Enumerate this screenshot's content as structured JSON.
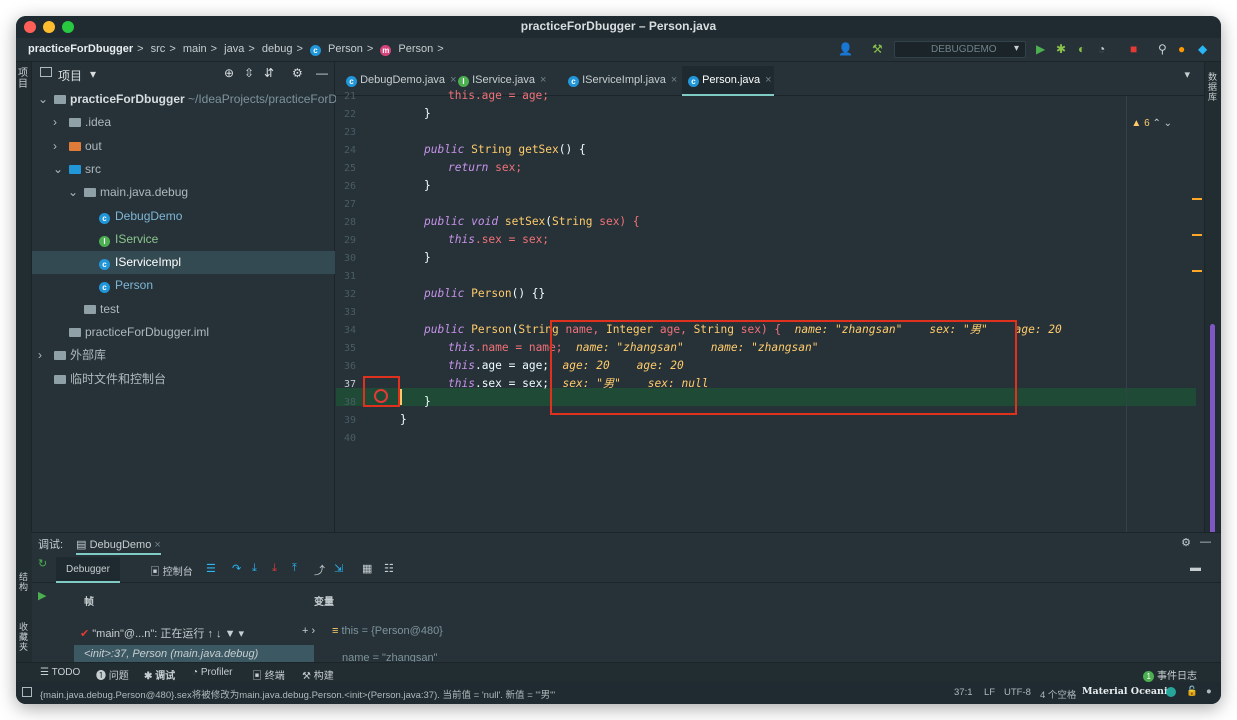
{
  "window": {
    "title": "practiceForDbugger – Person.java"
  },
  "navbar": {
    "crumbs": [
      "practiceForDbugger",
      "src",
      "main",
      "java",
      "debug",
      "Person",
      "Person"
    ],
    "sep": ">",
    "run_config": "DEBUGDEMO"
  },
  "project": {
    "title": "项目",
    "items": [
      {
        "label": "practiceForDbugger",
        "extra": "~/IdeaProjects/practiceForDl",
        "indent": 0,
        "arrow": "v",
        "icon": "module"
      },
      {
        "label": ".idea",
        "indent": 1,
        "arrow": ">",
        "icon": "folder"
      },
      {
        "label": "out",
        "indent": 1,
        "arrow": ">",
        "icon": "folder-orange"
      },
      {
        "label": "src",
        "indent": 1,
        "arrow": "v",
        "icon": "folder-blue"
      },
      {
        "label": "main.java.debug",
        "indent": 2,
        "arrow": "v",
        "icon": "package"
      },
      {
        "label": "DebugDemo",
        "indent": 3,
        "arrow": "",
        "icon": "class-run"
      },
      {
        "label": "IService",
        "indent": 3,
        "arrow": "",
        "icon": "interface"
      },
      {
        "label": "IServiceImpl",
        "indent": 3,
        "arrow": "",
        "icon": "class",
        "selected": true
      },
      {
        "label": "Person",
        "indent": 3,
        "arrow": "",
        "icon": "class"
      },
      {
        "label": "test",
        "indent": 2,
        "arrow": "",
        "icon": "folder"
      },
      {
        "label": "practiceForDbugger.iml",
        "indent": 1,
        "arrow": "",
        "icon": "iml"
      },
      {
        "label": "外部库",
        "indent": 0,
        "arrow": ">",
        "icon": "library"
      },
      {
        "label": "临时文件和控制台",
        "indent": 0,
        "arrow": "",
        "icon": "scratch"
      }
    ]
  },
  "tabs": [
    {
      "label": "DebugDemo.java",
      "icon": "class-run"
    },
    {
      "label": "IService.java",
      "icon": "interface"
    },
    {
      "label": "IServiceImpl.java",
      "icon": "class"
    },
    {
      "label": "Person.java",
      "icon": "class",
      "active": true
    }
  ],
  "editor": {
    "line_numbers": [
      "21",
      "22",
      "23",
      "24",
      "25",
      "26",
      "27",
      "28",
      "29",
      "30",
      "31",
      "32",
      "33",
      "34",
      "35",
      "36",
      "37",
      "38",
      "39",
      "40"
    ],
    "warning_count": "6",
    "code": {
      "l21": "this.age = age;",
      "l22": "}",
      "l24a": "public",
      "l24b": "String",
      "l24c": "getSex",
      "l24d": "() {",
      "l25a": "return",
      "l25b": "sex;",
      "l26": "}",
      "l28a": "public",
      "l28b": "void",
      "l28c": "setSex",
      "l28d": "(",
      "l28e": "String",
      "l28f": "sex) {",
      "l29a": "this",
      ".l29b": "",
      "l29c": ".sex = sex;",
      "l30": "}",
      "l32a": "public",
      "l32b": "Person",
      "l32c": "() {}",
      "l34a": "public",
      "l34b": "Person",
      "l34c": "(",
      "l34d": "String",
      "l34e": "name,",
      "l34f": "Integer",
      "l34g": "age,",
      "l34h": "String",
      "l34i": "sex) {",
      "l35a": "this",
      "l35b": ".name = name;",
      "l36a": "this",
      "l36b": ".age = age;",
      "l37a": "this",
      "l37b": ".sex = sex;",
      "l38": "}",
      "l39": "}"
    },
    "hints": {
      "h34": "name: \"zhangsan\"    sex: \"男\"    age: 20",
      "h35": "name: \"zhangsan\"    name: \"zhangsan\"",
      "h36": "age: 20    age: 20",
      "h37": "sex: \"男\"    sex: null"
    }
  },
  "debug": {
    "label": "调试:",
    "session": "DebugDemo",
    "tabs": [
      "Debugger",
      "控制台"
    ],
    "frames_header": "帧",
    "vars_header": "变量",
    "thread": "\"main\"@...n\": 正在运行",
    "frame_row": "<init>:37, Person (main.java.debug)",
    "var_row": "this = {Person@480}",
    "var_row2": "name = \"zhangsan\""
  },
  "toolwindows": [
    "TODO",
    "问题",
    "调试",
    "Profiler",
    "终端",
    "构建"
  ],
  "event_log": "事件日志",
  "event_count": "1",
  "status": {
    "message": "{main.java.debug.Person@480}.sex将被修改为main.java.debug.Person.<init>(Person.java:37). 当前值 = 'null'. 新值 = '\"男\"'",
    "position": "37:1",
    "line_sep": "LF",
    "encoding": "UTF-8",
    "indent": "4 个空格",
    "theme": "Material Oceanic"
  },
  "side_labels": {
    "project": "项目",
    "structure": "结构",
    "favorites": "收藏夹",
    "database": "数据库"
  }
}
